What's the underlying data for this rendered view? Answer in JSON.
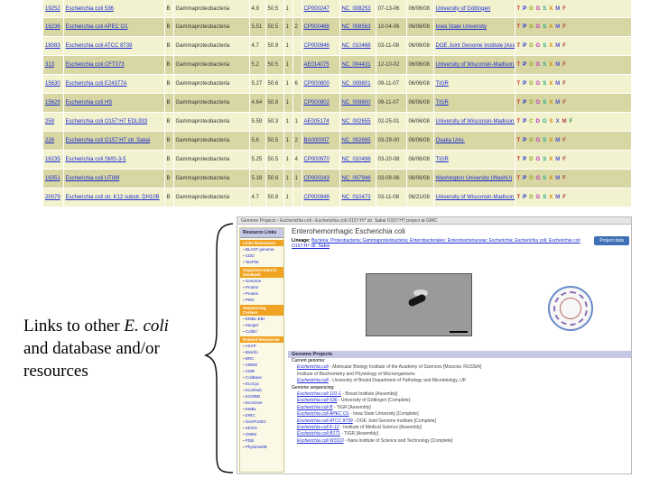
{
  "table": {
    "rows": [
      {
        "id": "19252",
        "organism": "Escherichia coli 536",
        "kingdom": "B",
        "group": "Gammaproteobacteria",
        "size": "4.9",
        "gc": "50.5",
        "chr": "1",
        "plasmids": "",
        "refseq": "CP000247",
        "ncbi": "NC_008253",
        "released": "07-13-06",
        "modified": "06/06/08",
        "center": "University of Göttingen",
        "links": [
          "T",
          "P",
          "D",
          "G",
          "S",
          "X",
          "M",
          "F"
        ]
      },
      {
        "id": "16236",
        "organism": "Escherichia coli APEC O1",
        "kingdom": "B",
        "group": "Gammaproteobacteria",
        "size": "5.51",
        "gc": "50.5",
        "chr": "1",
        "plasmids": "2",
        "refseq": "CP000468",
        "ncbi": "NC_008563",
        "released": "10-04-06",
        "modified": "06/06/08",
        "center": "Iowa State University",
        "links": [
          "T",
          "P",
          "D",
          "G",
          "S",
          "X",
          "M",
          "F"
        ]
      },
      {
        "id": "18083",
        "organism": "Escherichia coli ATCC 8739",
        "kingdom": "B",
        "group": "Gammaproteobacteria",
        "size": "4.7",
        "gc": "50.9",
        "chr": "1",
        "plasmids": "",
        "refseq": "CP000946",
        "ncbi": "NC_010468",
        "released": "03-11-08",
        "modified": "06/06/08",
        "center": "DOE Joint Genome Institute [Assembly]",
        "links": [
          "T",
          "P",
          "D",
          "G",
          "S",
          "X",
          "M",
          "F"
        ]
      },
      {
        "id": "313",
        "organism": "Escherichia coli CFT073",
        "kingdom": "B",
        "group": "Gammaproteobacteria",
        "size": "5.2",
        "gc": "50.5",
        "chr": "1",
        "plasmids": "",
        "refseq": "AE014075",
        "ncbi": "NC_004431",
        "released": "12-10-02",
        "modified": "06/06/08",
        "center": "University of Wisconsin-Madison, USA",
        "links": [
          "T",
          "P",
          "D",
          "G",
          "S",
          "X",
          "M",
          "F"
        ]
      },
      {
        "id": "15630",
        "organism": "Escherichia coli E24377A",
        "kingdom": "B",
        "group": "Gammaproteobacteria",
        "size": "5.27",
        "gc": "50.6",
        "chr": "1",
        "plasmids": "6",
        "refseq": "CP000800",
        "ncbi": "NC_009801",
        "released": "09-11-07",
        "modified": "06/06/08",
        "center": "TIGR",
        "links": [
          "T",
          "P",
          "D",
          "G",
          "S",
          "X",
          "M",
          "F"
        ]
      },
      {
        "id": "15629",
        "organism": "Escherichia coli HS",
        "kingdom": "B",
        "group": "Gammaproteobacteria",
        "size": "4.64",
        "gc": "50.8",
        "chr": "1",
        "plasmids": "",
        "refseq": "CP000802",
        "ncbi": "NC_009800",
        "released": "09-11-07",
        "modified": "06/06/08",
        "center": "TIGR",
        "links": [
          "T",
          "P",
          "D",
          "G",
          "S",
          "X",
          "M",
          "F"
        ]
      },
      {
        "id": "259",
        "organism": "Escherichia coli O157:H7 EDL933",
        "kingdom": "B",
        "group": "Gammaproteobacteria",
        "size": "5.59",
        "gc": "50.3",
        "chr": "1",
        "plasmids": "1",
        "refseq": "AE005174",
        "ncbi": "NC_002655",
        "released": "02-25-01",
        "modified": "06/06/08",
        "center": "University of Wisconsin-Madison, USA",
        "links": [
          "T",
          "P",
          "C",
          "D",
          "G",
          "S",
          "X",
          "M",
          "F"
        ]
      },
      {
        "id": "226",
        "organism": "Escherichia coli O157:H7 str. Sakai",
        "kingdom": "B",
        "group": "Gammaproteobacteria",
        "size": "5.6",
        "gc": "50.5",
        "chr": "1",
        "plasmids": "2",
        "refseq": "BA000007",
        "ncbi": "NC_002695",
        "released": "03-29-00",
        "modified": "06/06/08",
        "center": "Osaka Univ.",
        "links": [
          "T",
          "P",
          "D",
          "G",
          "S",
          "X",
          "M",
          "F"
        ]
      },
      {
        "id": "16235",
        "organism": "Escherichia coli SMS-3-5",
        "kingdom": "B",
        "group": "Gammaproteobacteria",
        "size": "5.25",
        "gc": "50.5",
        "chr": "1",
        "plasmids": "4",
        "refseq": "CP000970",
        "ncbi": "NC_010498",
        "released": "03-20-08",
        "modified": "06/06/08",
        "center": "TIGR",
        "links": [
          "T",
          "P",
          "D",
          "G",
          "S",
          "X",
          "M",
          "F"
        ]
      },
      {
        "id": "16351",
        "organism": "Escherichia coli UTI89",
        "kingdom": "B",
        "group": "Gammaproteobacteria",
        "size": "5.18",
        "gc": "50.6",
        "chr": "1",
        "plasmids": "1",
        "refseq": "CP000243",
        "ncbi": "NC_007946",
        "released": "03-09-06",
        "modified": "06/06/08",
        "center": "Washington University (WashU)",
        "links": [
          "T",
          "P",
          "D",
          "G",
          "S",
          "X",
          "M",
          "F"
        ]
      },
      {
        "id": "20079",
        "organism": "Escherichia coli str. K12 substr. DH10B",
        "kingdom": "B",
        "group": "Gammaproteobacteria",
        "size": "4.7",
        "gc": "50.8",
        "chr": "1",
        "plasmids": "",
        "refseq": "CP000948",
        "ncbi": "NC_010473",
        "released": "03-11-08",
        "modified": "06/21/08",
        "center": "University of Wisconsin-Madison, USA",
        "links": [
          "T",
          "P",
          "D",
          "G",
          "S",
          "X",
          "M",
          "F"
        ]
      }
    ]
  },
  "caption": {
    "line1_prefix": "Links to other ",
    "line1_italic": "E. coli",
    "line2": "and database and/or",
    "line3": "resources"
  },
  "screenshot": {
    "breadcrumb": "Genome Projects › Escherichia coli › Escherichia coli O157:H7 str. Sakai O157:H7 project at GIRC",
    "sidebar_tab": "Resource Links",
    "sections": [
      {
        "header": "Links Resources",
        "items": [
          "BLAST genome",
          "CDD",
          "TaxPlot"
        ]
      },
      {
        "header": "Organism Data in GenBank",
        "items": [
          "Genome",
          "Protein",
          "Protein",
          "PMC"
        ]
      },
      {
        "header": "Sequencing Centers",
        "items": [
          "EMBL-EBI",
          "Sanger",
          "Colibri"
        ]
      },
      {
        "header": "Related Resources",
        "items": [
          "ASAP",
          "Bioinfo",
          "BRC",
          "CBMG",
          "CMR",
          "ColiBase",
          "EcoCyc",
          "EcoliHub",
          "ECMDB",
          "EcoGene",
          "EMBL",
          "ERIC",
          "GenProtEC",
          "KEGG",
          "OMIM",
          "PDB",
          "PhylomeDB"
        ]
      }
    ],
    "entry_title": "Enterohemorrhagic Escherichia coli",
    "project_button": "Project data",
    "lineage_label": "Lineage:",
    "lineage": "Bacteria; Proteobacteria; Gammaproteobacteria; Enterobacteriales; Enterobacteriaceae; Escherichia; Escherichia coli; Escherichia coli O157:H7 str. Sakai",
    "genome_projects_header": "Genome Projects",
    "gp_rows": [
      {
        "cap": true,
        "text": "Current genome:"
      },
      {
        "link": "Escherichia coli",
        "text": " - Molecular Biology Institute of the Academy of Sciences [Moscow, RUSSIA]"
      },
      {
        "text": "Institute of Biochemistry and Physiology of Microorganisms"
      },
      {
        "link": "Escherichia coli",
        "text": " - University of Bristol Department of Pathology and Microbiology, UK"
      },
      {
        "cap": true,
        "text": "Genome sequencing:"
      },
      {
        "link": "Escherichia coli 101-1",
        "text": " - Broad Institute [Assembly]"
      },
      {
        "link": "Escherichia coli 536",
        "text": " - University of Göttingen [Complete]"
      },
      {
        "link": "Escherichia coli B",
        "text": " - TIGR [Assembly]"
      },
      {
        "link": "Escherichia coli APEC O1",
        "text": " - Iowa State University [Complete]"
      },
      {
        "link": "Escherichia coli ATCC 8739",
        "text": " - DOE Joint Genome Institute [Complete]"
      },
      {
        "link": "Escherichia coli K-12",
        "text": " - Institute of Medical Science [Assembly]"
      },
      {
        "link": "Escherichia coli B171",
        "text": " - TIGR [Assembly]"
      },
      {
        "link": "Escherichia coli W3110",
        "text": " - Nara Institute of Science and Technology [Complete]"
      }
    ]
  }
}
